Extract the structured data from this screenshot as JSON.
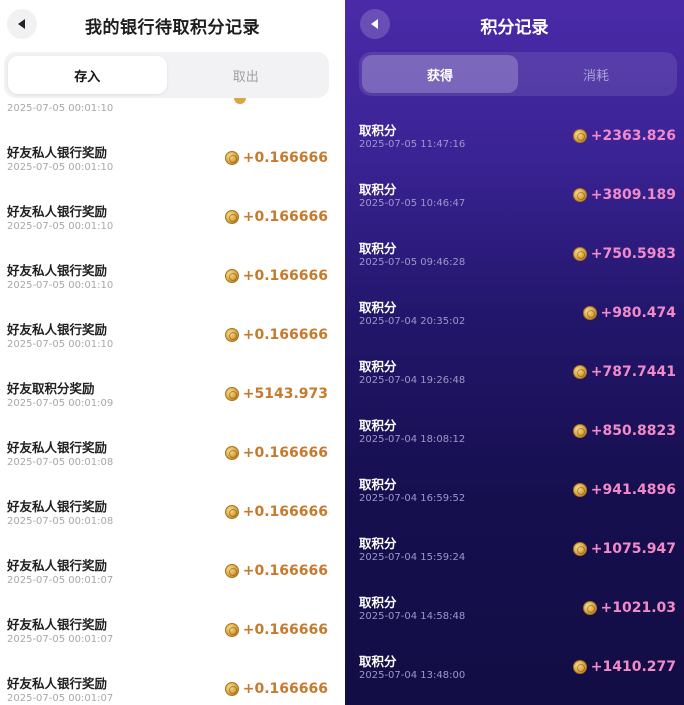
{
  "left": {
    "title": "我的银行待取积分记录",
    "tabs": [
      {
        "label": "存入",
        "active": true
      },
      {
        "label": "取出",
        "active": false
      }
    ],
    "partial_time": "2025-07-05 00:01:10",
    "records": [
      {
        "name": "好友私人银行奖励",
        "time": "2025-07-05 00:01:10",
        "amount": "+0.166666"
      },
      {
        "name": "好友私人银行奖励",
        "time": "2025-07-05 00:01:10",
        "amount": "+0.166666"
      },
      {
        "name": "好友私人银行奖励",
        "time": "2025-07-05 00:01:10",
        "amount": "+0.166666"
      },
      {
        "name": "好友私人银行奖励",
        "time": "2025-07-05 00:01:10",
        "amount": "+0.166666"
      },
      {
        "name": "好友取积分奖励",
        "time": "2025-07-05 00:01:09",
        "amount": "+5143.973"
      },
      {
        "name": "好友私人银行奖励",
        "time": "2025-07-05 00:01:08",
        "amount": "+0.166666"
      },
      {
        "name": "好友私人银行奖励",
        "time": "2025-07-05 00:01:08",
        "amount": "+0.166666"
      },
      {
        "name": "好友私人银行奖励",
        "time": "2025-07-05 00:01:07",
        "amount": "+0.166666"
      },
      {
        "name": "好友私人银行奖励",
        "time": "2025-07-05 00:01:07",
        "amount": "+0.166666"
      },
      {
        "name": "好友私人银行奖励",
        "time": "2025-07-05 00:01:07",
        "amount": "+0.166666"
      }
    ]
  },
  "right": {
    "title": "积分记录",
    "tabs": [
      {
        "label": "获得",
        "active": true
      },
      {
        "label": "消耗",
        "active": false
      }
    ],
    "records": [
      {
        "name": "取积分",
        "time": "2025-07-05 11:47:16",
        "amount": "+2363.826"
      },
      {
        "name": "取积分",
        "time": "2025-07-05 10:46:47",
        "amount": "+3809.189"
      },
      {
        "name": "取积分",
        "time": "2025-07-05 09:46:28",
        "amount": "+750.5983"
      },
      {
        "name": "取积分",
        "time": "2025-07-04 20:35:02",
        "amount": "+980.474"
      },
      {
        "name": "取积分",
        "time": "2025-07-04 19:26:48",
        "amount": "+787.7441"
      },
      {
        "name": "取积分",
        "time": "2025-07-04 18:08:12",
        "amount": "+850.8823"
      },
      {
        "name": "取积分",
        "time": "2025-07-04 16:59:52",
        "amount": "+941.4896"
      },
      {
        "name": "取积分",
        "time": "2025-07-04 15:59:24",
        "amount": "+1075.947"
      },
      {
        "name": "取积分",
        "time": "2025-07-04 14:58:48",
        "amount": "+1021.03"
      },
      {
        "name": "取积分",
        "time": "2025-07-04 13:48:00",
        "amount": "+1410.277"
      }
    ]
  },
  "icons": {
    "back": "back-arrow-icon",
    "coin": "gold-coin-icon"
  },
  "colors": {
    "left_amount": "#c7792c",
    "right_amount": "#f38ac8",
    "right_bg_top": "#4b2aa8",
    "right_bg_bottom": "#120d44"
  }
}
